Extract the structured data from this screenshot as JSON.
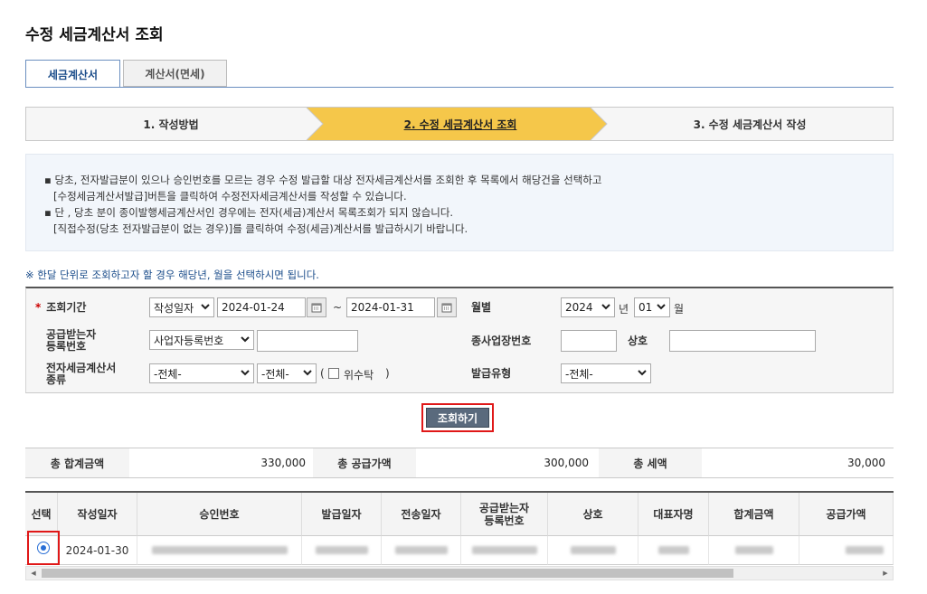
{
  "page": {
    "title": "수정 세금계산서 조회"
  },
  "tabs": [
    {
      "label": "세금계산서",
      "active": true
    },
    {
      "label": "계산서(면세)",
      "active": false
    }
  ],
  "steps": [
    {
      "label": "1. 작성방법",
      "current": false
    },
    {
      "label": "2. 수정 세금계산서 조회",
      "current": true
    },
    {
      "label": "3. 수정 세금계산서 작성",
      "current": false
    }
  ],
  "notice": {
    "lines": [
      "▪ 당초, 전자발급분이 있으나 승인번호를 모르는 경우 수정 발급할 대상 전자세금계산서를 조회한 후 목록에서 해당건을 선택하고",
      "[수정세금계산서발급]버튼을 클릭하여 수정전자세금계산서를 작성할 수 있습니다.",
      "▪ 단 , 당초 분이 종이발행세금계산서인 경우에는 전자(세금)계산서 목록조회가 되지 않습니다.",
      "[직접수정(당초 전자발급분이 없는 경우)]를 클릭하여 수정(세금)계산서를 발급하시기 바랍니다."
    ]
  },
  "hint": "※ 한달 단위로 조회하고자 할 경우 해당년, 월을 선택하시면 됩니다.",
  "form": {
    "required_mark": "*",
    "period_label": "조회기간",
    "date_type": "작성일자",
    "date_from": "2024-01-24",
    "date_sep": "~",
    "date_to": "2024-01-31",
    "month_label": "월별",
    "year": "2024",
    "year_unit": "년",
    "month": "01",
    "month_unit": "월",
    "buyer_label_1": "공급받는자",
    "buyer_label_2": "등록번호",
    "buyer_type": "사업자등록번호",
    "buyer_no": "",
    "branch_label": "종사업장번호",
    "branch_no": "",
    "company_label": "상호",
    "company_name": "",
    "kind_label_1": "전자세금계산서",
    "kind_label_2": "종류",
    "kind_1": "-전체-",
    "kind_2": "-전체-",
    "consign_open": "(",
    "consign_label": "위수탁",
    "consign_close": ")",
    "issue_type_label": "발급유형",
    "issue_type": "-전체-"
  },
  "search_button": "조회하기",
  "totals": {
    "total_label": "총 합계금액",
    "total_value": "330,000",
    "supply_label": "총 공급가액",
    "supply_value": "300,000",
    "tax_label": "총 세액",
    "tax_value": "30,000"
  },
  "table": {
    "headers": {
      "select": "선택",
      "write_date": "작성일자",
      "approval_no": "승인번호",
      "issue_date": "발급일자",
      "send_date": "전송일자",
      "buyer_no_1": "공급받는자",
      "buyer_no_2": "등록번호",
      "company": "상호",
      "ceo": "대표자명",
      "total": "합계금액",
      "supply": "공급가액"
    },
    "rows": [
      {
        "selected": true,
        "write_date": "2024-01-30"
      }
    ]
  },
  "colors": {
    "accent": "#f5c74a",
    "primary": "#1a4c8a",
    "highlight": "#e01818",
    "button": "#5a6a7d"
  }
}
